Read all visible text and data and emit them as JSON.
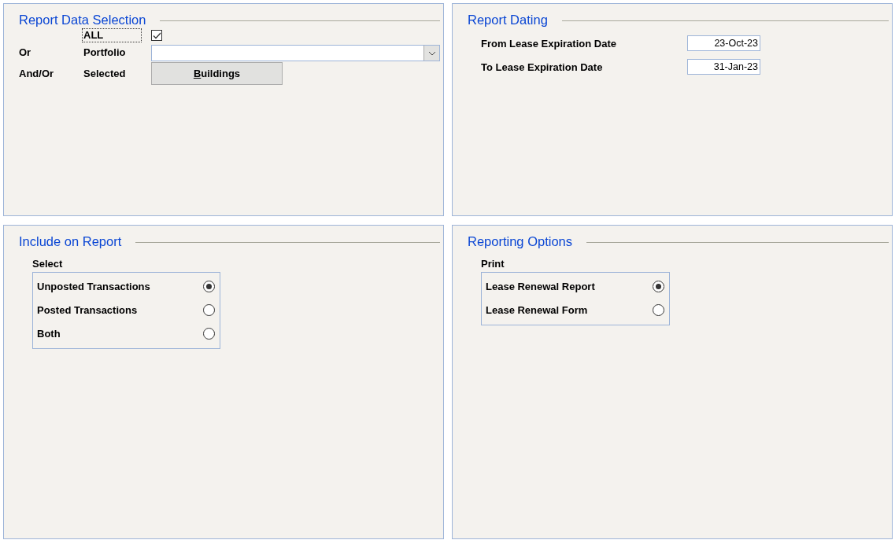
{
  "data_selection": {
    "title": "Report Data Selection",
    "all": {
      "label": "ALL",
      "checked": true
    },
    "portfolio": {
      "prefix": "Or",
      "label": "Portfolio"
    },
    "selected": {
      "prefix": "And/Or",
      "label": "Selected",
      "button": "Buildings",
      "first_letter_underlined": true
    }
  },
  "dating": {
    "title": "Report Dating",
    "fields": [
      {
        "label": "From Lease Expiration Date",
        "value": "23-Oct-23"
      },
      {
        "label": "To Lease Expiration Date",
        "value": "31-Jan-23"
      }
    ]
  },
  "include": {
    "title": "Include on Report",
    "group_label": "Select",
    "options": [
      {
        "label": "Unposted Transactions",
        "selected": true
      },
      {
        "label": "Posted Transactions",
        "selected": false
      },
      {
        "label": "Both",
        "selected": false
      }
    ]
  },
  "reporting": {
    "title": "Reporting Options",
    "group_label": "Print",
    "options": [
      {
        "label": "Lease Renewal Report",
        "selected": true
      },
      {
        "label": "Lease Renewal Form",
        "selected": false
      }
    ]
  }
}
